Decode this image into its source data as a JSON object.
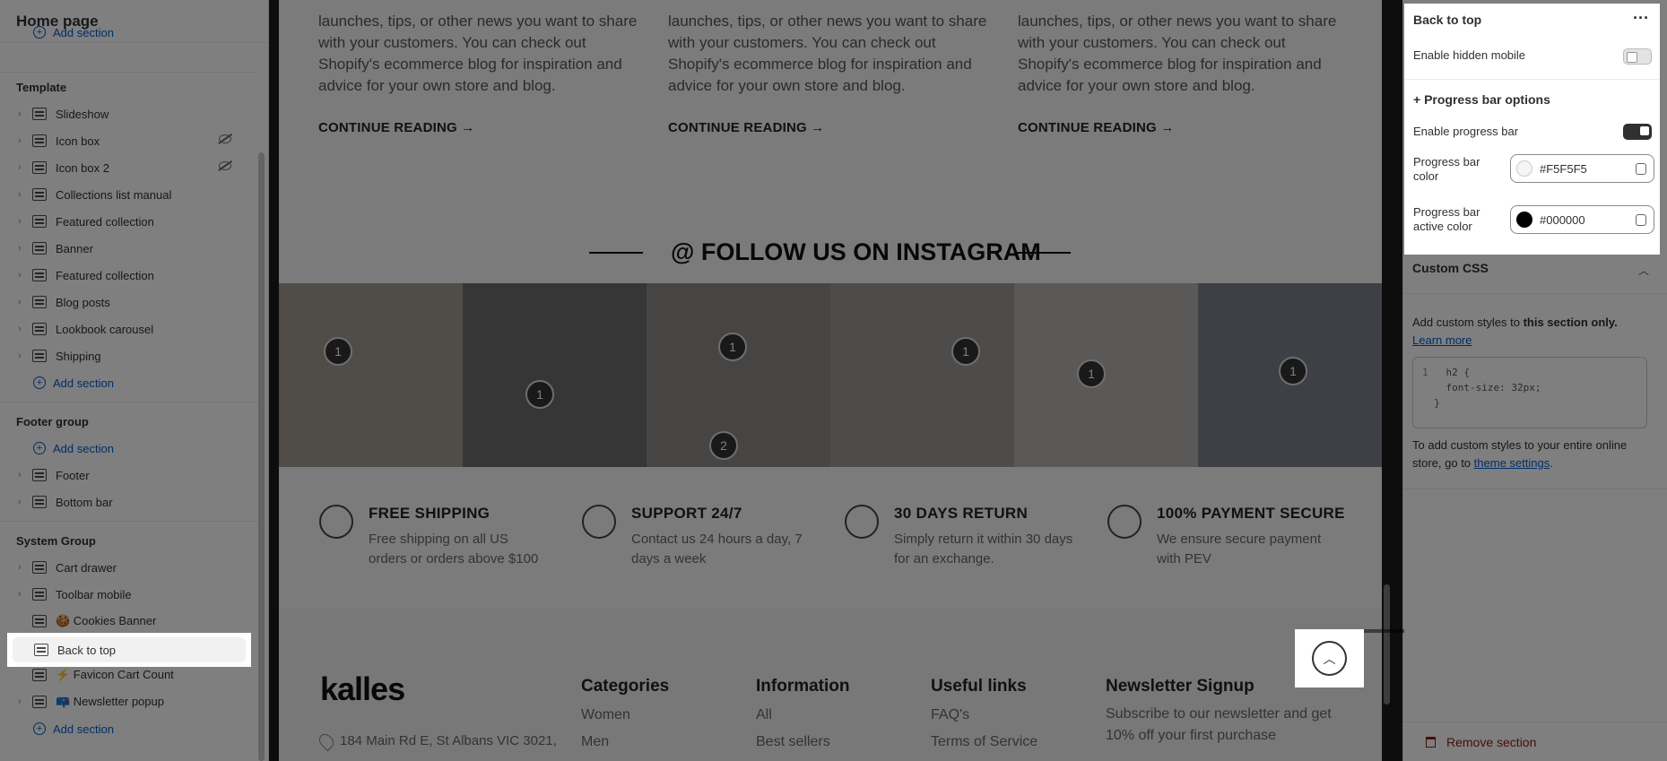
{
  "sidebar": {
    "title": "Home page",
    "top_add": "Add section",
    "template_label": "Template",
    "template_items": [
      {
        "label": "Slideshow",
        "hidden": false
      },
      {
        "label": "Icon box",
        "hidden": true
      },
      {
        "label": "Icon box 2",
        "hidden": true
      },
      {
        "label": "Collections list manual",
        "hidden": false
      },
      {
        "label": "Featured collection",
        "hidden": false
      },
      {
        "label": "Banner",
        "hidden": false
      },
      {
        "label": "Featured collection",
        "hidden": false
      },
      {
        "label": "Blog posts",
        "hidden": false
      },
      {
        "label": "Lookbook carousel",
        "hidden": false
      },
      {
        "label": "Shipping",
        "hidden": false
      }
    ],
    "template_add": "Add section",
    "footer_group_label": "Footer group",
    "footer_add": "Add section",
    "footer_items": [
      "Footer",
      "Bottom bar"
    ],
    "system_group_label": "System Group",
    "system_items": [
      "Cart drawer",
      "Toolbar mobile",
      "🍪 Cookies Banner",
      "Back to top",
      "⚡ Favicon Cart Count",
      "📪 Newsletter popup"
    ],
    "system_add": "Add section"
  },
  "preview": {
    "blog_posts": [
      {
        "text": "launches, tips, or other news you want to share with your customers. You can check out Shopify's ecommerce blog for inspiration and advice for your own store and blog.",
        "link": "CONTINUE READING →"
      },
      {
        "text": "launches, tips, or other news you want to share with your customers. You can check out Shopify's ecommerce blog for inspiration and advice for your own store and blog.",
        "link": "CONTINUE READING →"
      },
      {
        "text": "launches, tips, or other news you want to share with your customers. You can check out Shopify's ecommerce blog for inspiration and advice for your own store and blog.",
        "link": "CONTINUE READING →"
      }
    ],
    "instagram_title": "@ FOLLOW US ON INSTAGRAM",
    "instagram_pins": [
      [
        "1"
      ],
      [
        "1"
      ],
      [
        "1",
        "2"
      ],
      [
        "1"
      ],
      [
        "1"
      ],
      [
        "1"
      ]
    ],
    "features": [
      {
        "title": "FREE SHIPPING",
        "text": "Free shipping on all US orders or orders above $100"
      },
      {
        "title": "SUPPORT 24/7",
        "text": "Contact us 24 hours a day, 7 days a week"
      },
      {
        "title": "30 DAYS RETURN",
        "text": "Simply return it within 30 days for an exchange."
      },
      {
        "title": "100% PAYMENT SECURE",
        "text": "We ensure secure payment with PEV"
      }
    ],
    "footer": {
      "logo": "kalles",
      "address": "184 Main Rd E, St Albans VIC 3021,",
      "categories": {
        "title": "Categories",
        "links": [
          "Women",
          "Men"
        ]
      },
      "information": {
        "title": "Information",
        "links": [
          "All",
          "Best sellers"
        ]
      },
      "useful": {
        "title": "Useful links",
        "links": [
          "FAQ's",
          "Terms of Service"
        ]
      },
      "newsletter": {
        "title": "Newsletter Signup",
        "text": "Subscribe to our newsletter and get 10% off your first purchase"
      }
    }
  },
  "settings": {
    "title": "Back to top",
    "enable_hidden_mobile": "Enable hidden mobile",
    "progress_options": "+ Progress bar options",
    "enable_progress_bar": "Enable progress bar",
    "progress_color_label": "Progress bar color",
    "progress_color": "#F5F5F5",
    "progress_active_label": "Progress bar active color",
    "progress_active_color": "#000000",
    "custom_css_title": "Custom CSS",
    "custom_css_desc_1": "Add custom styles to",
    "custom_css_desc_2": "this section only.",
    "learn_more": "Learn more",
    "code_line_num": "1",
    "code": "h2 {\n    font-size: 32px;\n  }",
    "global_note_1": "To add custom styles to your entire online store, go to",
    "theme_settings": "theme settings",
    "remove_section": "Remove section"
  },
  "colors": {
    "accent": "#005bd3",
    "danger": "#8e1f0b"
  }
}
